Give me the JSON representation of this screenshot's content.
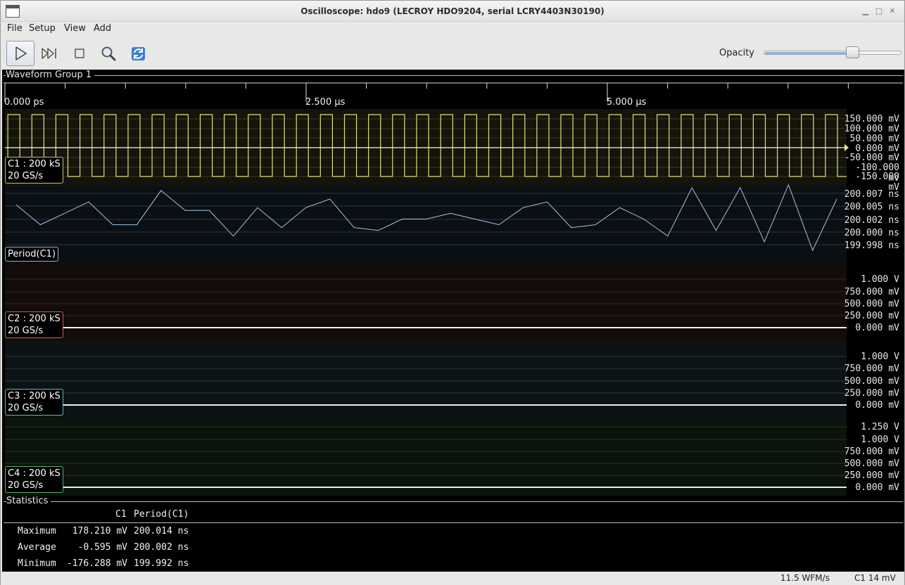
{
  "window": {
    "title": "Oscilloscope: hdo9 (LECROY HDO9204, serial LCRY4403N30190)"
  },
  "menu": [
    "File",
    "Setup",
    "View",
    "Add"
  ],
  "toolbar": {
    "buttons": [
      {
        "name": "run-icon",
        "active": true
      },
      {
        "name": "single-step-icon",
        "active": false
      },
      {
        "name": "stop-icon",
        "active": false
      },
      {
        "name": "zoom-icon",
        "active": false
      },
      {
        "name": "refresh-icon",
        "active": false
      }
    ],
    "opacity_label": "Opacity",
    "opacity_value": 0.66
  },
  "group": {
    "label": "Waveform Group 1",
    "time_labels": [
      "0.000 ps",
      "2.500 µs",
      "5.000 µs"
    ]
  },
  "channels": [
    {
      "id": "C1",
      "label_line1": "C1 : 200 kS",
      "label_line2": "20 GS/s",
      "color": "#e2e07c",
      "axis_labels": [
        "150.000 mV",
        "100.000 mV",
        "50.000 mV",
        "0.000 mV",
        "-50.000 mV",
        "-100.000 mV",
        "-150.000 mV"
      ]
    },
    {
      "id": "Period(C1)",
      "label_line1": "Period(C1)",
      "color": "#9fc7e6",
      "axis_labels": [
        "200.007 ns",
        "200.005 ns",
        "200.002 ns",
        "200.000 ns",
        "199.998 ns"
      ],
      "values_ns": [
        200.005,
        200.0015,
        200.0035,
        200.0055,
        200.0015,
        200.0015,
        200.0075,
        200.004,
        200.004,
        199.9995,
        200.0045,
        200.001,
        200.0045,
        200.006,
        200.001,
        200.0005,
        200.0025,
        200.0025,
        200.0035,
        200.0025,
        200.0015,
        200.0045,
        200.0055,
        200.001,
        200.0015,
        200.0045,
        200.0025,
        199.9995,
        200.008,
        200.0005,
        200.008,
        199.9985,
        200.0085,
        199.997,
        200.006
      ]
    },
    {
      "id": "C2",
      "label_line1": "C2 : 200 kS",
      "label_line2": "20 GS/s",
      "color": "#e07070",
      "axis_labels": [
        "1.000 V",
        "750.000 mV",
        "500.000 mV",
        "250.000 mV",
        "0.000 mV"
      ]
    },
    {
      "id": "C3",
      "label_line1": "C3 : 200 kS",
      "label_line2": "20 GS/s",
      "color": "#70c8d0",
      "axis_labels": [
        "1.000 V",
        "750.000 mV",
        "500.000 mV",
        "250.000 mV",
        "0.000 mV"
      ]
    },
    {
      "id": "C4",
      "label_line1": "C4 : 200 kS",
      "label_line2": "20 GS/s",
      "color": "#6cc07c",
      "axis_labels": [
        "1.250 V",
        "1.000 V",
        "750.000 mV",
        "500.000 mV",
        "250.000 mV",
        "0.000 mV"
      ]
    }
  ],
  "statistics": {
    "title": "Statistics",
    "columns": [
      "C1",
      "Period(C1)"
    ],
    "rows": [
      {
        "label": "Maximum",
        "c1": "178.210 mV",
        "period": "200.014 ns"
      },
      {
        "label": "Average",
        "c1": "-0.595 mV",
        "period": "200.002 ns"
      },
      {
        "label": "Minimum",
        "c1": "-176.288 mV",
        "period": "199.992 ns"
      }
    ]
  },
  "status": {
    "rate": "11.5 WFM/s",
    "trigger": "C1 14 mV"
  }
}
